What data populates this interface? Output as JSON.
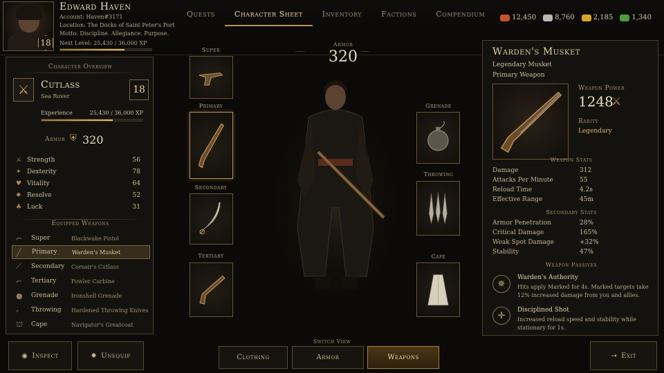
{
  "player": {
    "name": "Edward Haven",
    "account": "Account: Haven#3171",
    "location": "Location: The Docks of Saint Peter's Port",
    "motto": "Motto: Discipline. Allegiance. Purpose.",
    "next_level": "Next Level: 25,430 / 36,000 XP",
    "level": "18",
    "xp_progress": 0.706
  },
  "tabs": [
    {
      "label": "Quests"
    },
    {
      "label": "Character Sheet",
      "active": true
    },
    {
      "label": "Inventory"
    },
    {
      "label": "Factions"
    },
    {
      "label": "Compendium"
    }
  ],
  "resources": [
    {
      "icon": "ore-icon",
      "value": "12,450",
      "color": "#c8502c"
    },
    {
      "icon": "silver-icon",
      "value": "8,760",
      "color": "#b8b8b0"
    },
    {
      "icon": "gold-icon",
      "value": "2,185",
      "color": "#d9a227"
    },
    {
      "icon": "herb-icon",
      "value": "1,340",
      "color": "#4f9a3c"
    }
  ],
  "overview": {
    "title": "Character Overview",
    "class_name": "Cutlass",
    "class_sub": "Sea Rover",
    "level": "18",
    "experience_label": "Experience",
    "experience_value": "25,430 / 36,000 XP",
    "experience_progress": 0.706,
    "armor_label": "Armor",
    "armor_value": "320"
  },
  "stats": [
    {
      "icon": "strength-icon",
      "glyph": "⚔",
      "label": "Strength",
      "value": "56"
    },
    {
      "icon": "dexterity-icon",
      "glyph": "✦",
      "label": "Dexterity",
      "value": "78"
    },
    {
      "icon": "vitality-icon",
      "glyph": "♥",
      "label": "Vitality",
      "value": "64"
    },
    {
      "icon": "resolve-icon",
      "glyph": "✸",
      "label": "Resolve",
      "value": "52"
    },
    {
      "icon": "luck-icon",
      "glyph": "♣",
      "label": "Luck",
      "value": "31"
    }
  ],
  "equipped": {
    "title": "Equipped Weapons",
    "items": [
      {
        "slot": "Super",
        "name": "Blackwake Pistol"
      },
      {
        "slot": "Primary",
        "name": "Warden's Musket",
        "selected": true
      },
      {
        "slot": "Secondary",
        "name": "Corsair's Cutlass"
      },
      {
        "slot": "Tertiary",
        "name": "Fowler Carbine"
      },
      {
        "slot": "Grenade",
        "name": "Ironshell Grenade"
      },
      {
        "slot": "Throwing",
        "name": "Hardened Throwing Knives"
      },
      {
        "slot": "Cape",
        "name": "Navigator's Greatcoat"
      }
    ]
  },
  "buttons": {
    "inspect": "Inspect",
    "unequip": "Unequip",
    "exit": "Exit",
    "switch_view": "Switch View",
    "views": [
      "Clothing",
      "Armor",
      "Weapons"
    ],
    "active_view": "Weapons"
  },
  "center": {
    "armor_label": "Armor",
    "armor_total": "320",
    "slots": {
      "super": "Super",
      "primary": "Primary",
      "secondary": "Secondary",
      "tertiary": "Tertiary",
      "grenade": "Grenade",
      "throwing": "Throwing",
      "cape": "Cape"
    }
  },
  "weapon": {
    "name": "Warden's Musket",
    "type": "Legendary Musket",
    "slot": "Primary Weapon",
    "power_label": "Weapon Power",
    "power": "1248",
    "rarity_label": "Rarity",
    "rarity": "Legendary",
    "stats_title": "Weapon Stats",
    "stats": [
      {
        "k": "Damage",
        "v": "312"
      },
      {
        "k": "Attacks Per Minute",
        "v": "55"
      },
      {
        "k": "Reload Time",
        "v": "4.2s"
      },
      {
        "k": "Effective Range",
        "v": "45m"
      }
    ],
    "secondary_title": "Secondary Stats",
    "secondary": [
      {
        "k": "Armor Penetration",
        "v": "28%"
      },
      {
        "k": "Critical Damage",
        "v": "165%"
      },
      {
        "k": "Weak Spot Damage",
        "v": "+32%"
      },
      {
        "k": "Stability",
        "v": "47%"
      }
    ],
    "passives_title": "Weapon Passives",
    "passives": [
      {
        "name": "Warden's Authority",
        "desc": "Hits apply Marked for 4s. Marked targets take 12% increased damage from you and allies."
      },
      {
        "name": "Disciplined Shot",
        "desc": "Increased reload speed and stability while stationary for 1s."
      }
    ]
  }
}
